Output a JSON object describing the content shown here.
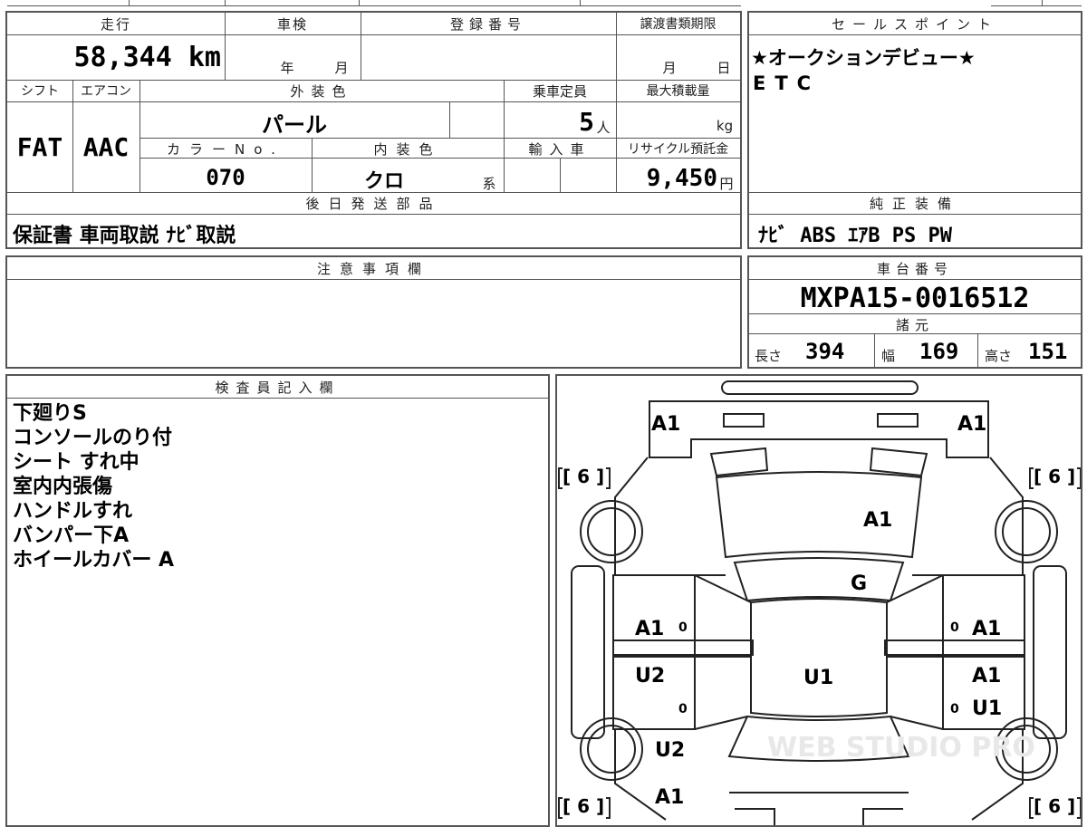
{
  "vehicle": {
    "mileage_label": "走行",
    "mileage": "58,344 km",
    "inspection_label": "車検",
    "inspection_year_unit": "年",
    "inspection_month_unit": "月",
    "registration_label": "登録番号",
    "transfer_deadline_label": "譲渡書類期限",
    "transfer_month_unit": "月",
    "transfer_day_unit": "日",
    "shift_label": "シフト",
    "shift": "FAT",
    "aircon_label": "エアコン",
    "aircon": "AAC",
    "exterior_label": "外装色",
    "exterior_color": "パール",
    "capacity_label": "乗車定員",
    "capacity": "5",
    "capacity_unit": "人",
    "max_load_label": "最大積載量",
    "max_load_unit": "kg",
    "color_no_label": "カラーNo.",
    "color_no": "070",
    "interior_label": "内装色",
    "interior_color": "クロ",
    "interior_suffix": "系",
    "import_label": "輸入車",
    "recycle_label": "リサイクル預託金",
    "recycle_fee": "9,450",
    "recycle_unit": "円"
  },
  "sales_points": {
    "header": "セールスポイント",
    "lines": [
      "★オークションデビュー★",
      "ETC"
    ]
  },
  "later_parts": {
    "header": "後日発送部品",
    "value": "保証書 車両取説 ﾅﾋﾞ取説"
  },
  "standard_equipment": {
    "header": "純正装備",
    "value": "ﾅﾋﾞ ABS ｴｱB PS PW"
  },
  "notes": {
    "header": "注意事項欄"
  },
  "chassis": {
    "header": "車台番号",
    "value": "MXPA15-0016512"
  },
  "specs": {
    "header": "諸元",
    "length_label": "長さ",
    "length": "394",
    "width_label": "幅",
    "width": "169",
    "height_label": "高さ",
    "height": "151"
  },
  "inspector": {
    "header": "検査員記入欄",
    "lines": [
      "下廻りS",
      "コンソールのり付",
      "シート すれ中",
      "室内内張傷",
      "ハンドルすれ",
      "バンパー下A",
      "ホイールカバー A"
    ]
  },
  "diagram": {
    "marks": {
      "front_left": "A1",
      "front_right": "A1",
      "hood": "A1",
      "windshield": "G",
      "roof": "U1",
      "left_front_door": "A1",
      "left_front_door_zero": "0",
      "left_rear_door": "U2",
      "left_rear_door_zero": "0",
      "left_rear_quarter": "U2",
      "rear": "A1",
      "right_front_door": "A1",
      "right_front_door_zero": "0",
      "right_rear_door_a": "A1",
      "right_rear_door_u": "U1",
      "right_rear_door_zero": "0",
      "tire_front_left": "[ 6 ]",
      "tire_front_right": "[ 6 ]",
      "tire_rear_left": "[ 6 ]",
      "tire_rear_right": "[ 6 ]"
    },
    "watermark": "WEB STUDIO PRO"
  }
}
